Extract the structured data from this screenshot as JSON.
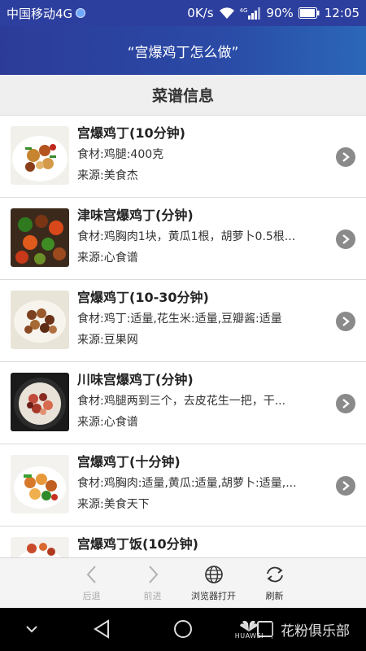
{
  "status_bar": {
    "carrier": "中国移动4G",
    "speed": "0K/s",
    "net_type": "4G",
    "battery": "90%",
    "time": "12:05"
  },
  "title": "“宫爆鸡丁怎么做”",
  "section_header": "菜谱信息",
  "recipes": [
    {
      "title": "宫爆鸡丁(10分钟)",
      "ingredients": "食材:鸡腿:400克",
      "source": "来源:美食杰"
    },
    {
      "title": "津味宫爆鸡丁(分钟)",
      "ingredients": "食材:鸡胸肉1块，黄瓜1根，胡萝卜0.5根...",
      "source": "来源:心食谱"
    },
    {
      "title": "宫爆鸡丁(10-30分钟)",
      "ingredients": "食材:鸡丁:适量,花生米:适量,豆瓣酱:适量",
      "source": "来源:豆果网"
    },
    {
      "title": "川味宫爆鸡丁(分钟)",
      "ingredients": "食材:鸡腿两到三个，去皮花生一把，干...",
      "source": "来源:心食谱"
    },
    {
      "title": "宫爆鸡丁(十分钟)",
      "ingredients": "食材:鸡胸肉:适量,黄瓜:适量,胡萝卜:适量,...",
      "source": "来源:美食天下"
    },
    {
      "title": "宫爆鸡丁饭(10分钟)",
      "ingredients": "",
      "source": ""
    }
  ],
  "toolbar": {
    "back": "后退",
    "forward": "前进",
    "open_browser": "浏览器打开",
    "refresh": "刷新"
  },
  "watermark": {
    "brand": "HUAWEI",
    "club": "花粉俱乐部"
  },
  "colors": {
    "title_bar": "#2c3b98",
    "section_bg": "#efefef",
    "arrow_btn": "#8a8a8a"
  }
}
